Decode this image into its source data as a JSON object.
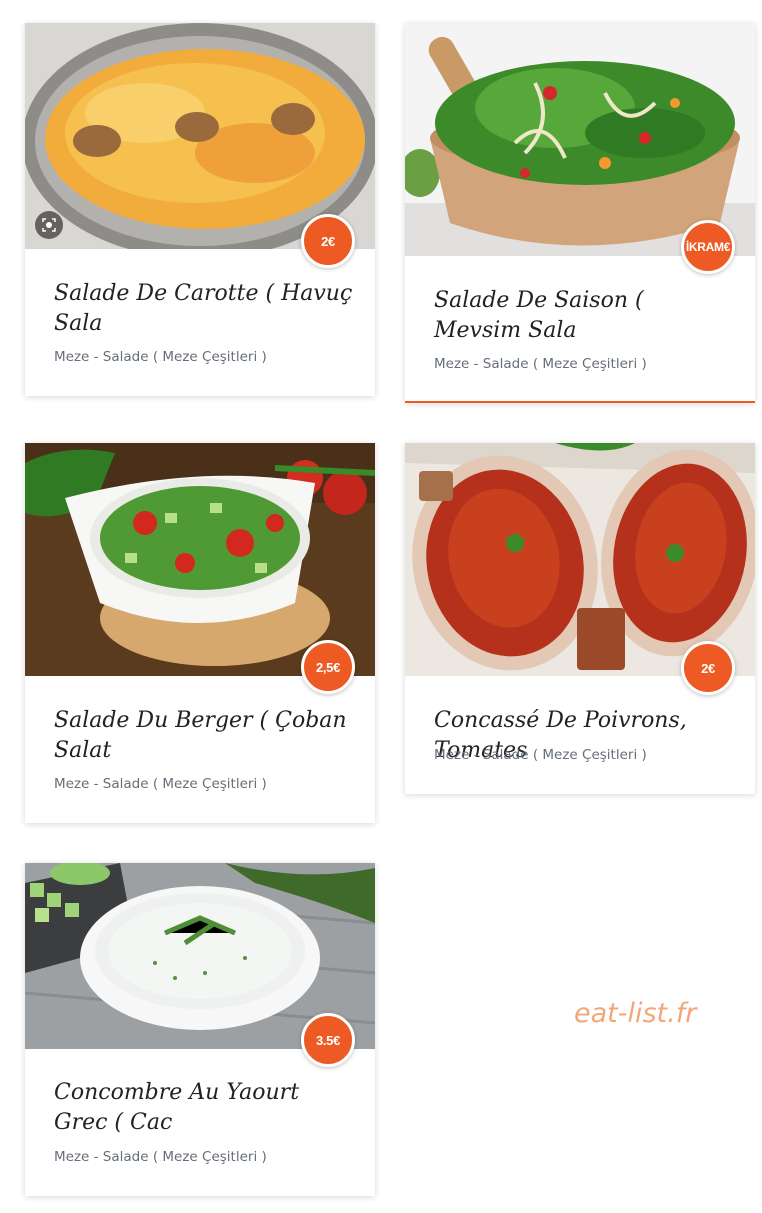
{
  "items": [
    {
      "title": "Salade De Carotte ( Havuç Sala",
      "category": "Meze - Salade ( Meze Çeşitleri )",
      "price": "2€",
      "image": "carrot-salad-photo"
    },
    {
      "title": "Salade De Saison ( Mevsim Sala",
      "category": "Meze - Salade ( Meze Çeşitleri )",
      "price": "İKRAM€",
      "image": "seasonal-salad-photo"
    },
    {
      "title": "Salade Du Berger ( Çoban Salat",
      "category": "Meze - Salade ( Meze Çeşitleri )",
      "price": "2,5€",
      "image": "shepherd-salad-photo"
    },
    {
      "title": "Concassé De Poivrons, Tomates",
      "category": "Meze - Salade ( Meze Çeşitleri )",
      "price": "2€",
      "image": "pepper-tomato-dip-photo"
    },
    {
      "title": "Concombre Au Yaourt Grec ( Cac",
      "category": "Meze - Salade ( Meze Çeşitleri )",
      "price": "3.5€",
      "image": "cucumber-yogurt-photo"
    }
  ],
  "watermark": "eat-list.fr",
  "colors": {
    "accent": "#ee5a24",
    "title": "#222222",
    "category": "#666e78",
    "watermark": "#f2a778"
  }
}
